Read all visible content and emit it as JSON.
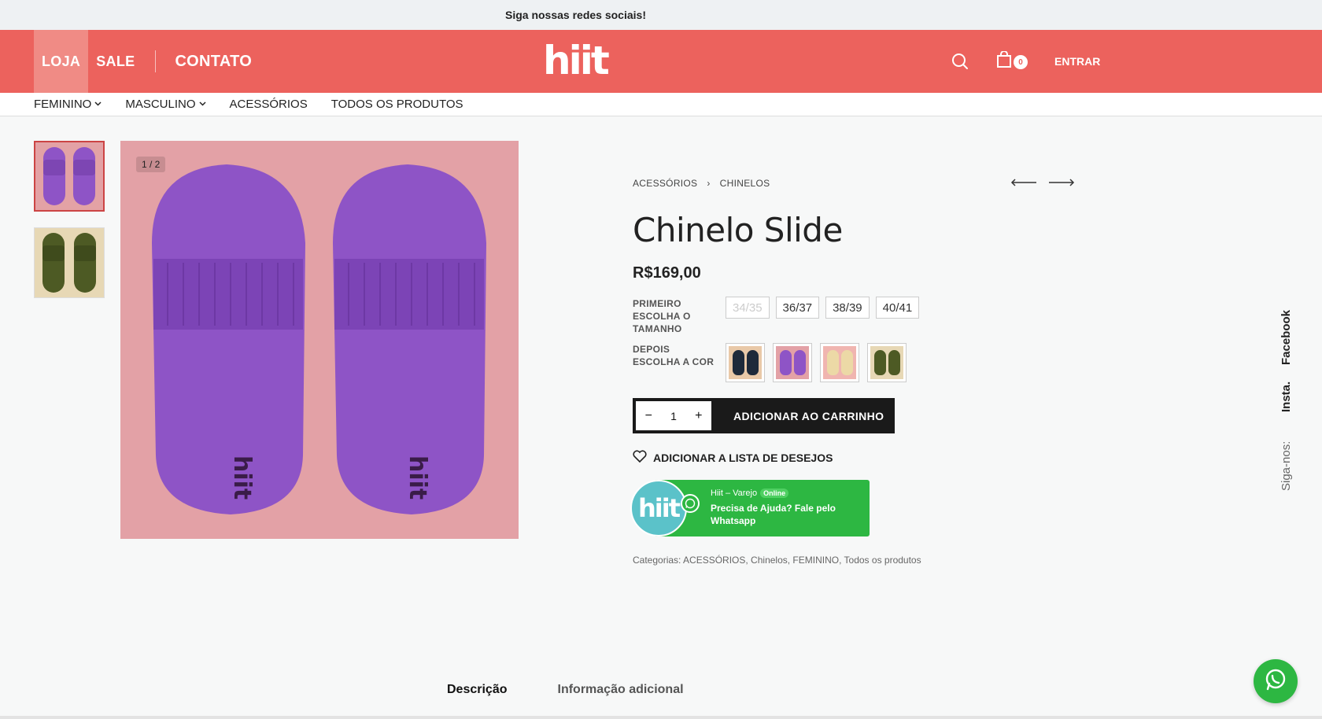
{
  "topbar": {
    "message": "Siga nossas redes sociais!"
  },
  "header": {
    "nav": {
      "loja": "LOJA",
      "sale": "SALE",
      "contato": "CONTATO"
    },
    "logo": "hiit",
    "cart_count": "0",
    "login": "ENTRAR",
    "colors": {
      "brand": "#ec625d"
    }
  },
  "catnav": {
    "items": [
      {
        "label": "FEMININO",
        "has_dropdown": true
      },
      {
        "label": "MASCULINO",
        "has_dropdown": true
      },
      {
        "label": "ACESSÓRIOS",
        "has_dropdown": false
      },
      {
        "label": "TODOS OS PRODUTOS",
        "has_dropdown": false
      }
    ]
  },
  "gallery": {
    "counter": "1 / 2",
    "thumbs": [
      "purple-slide",
      "olive-slide"
    ]
  },
  "product": {
    "breadcrumb": [
      "ACESSÓRIOS",
      "CHINELOS"
    ],
    "breadcrumb_sep": "›",
    "title": "Chinelo Slide",
    "price": "R$169,00",
    "size_label": "PRIMEIRO ESCOLHA O TAMANHO",
    "sizes": [
      {
        "label": "34/35",
        "available": false
      },
      {
        "label": "36/37",
        "available": true
      },
      {
        "label": "38/39",
        "available": true
      },
      {
        "label": "40/41",
        "available": true
      }
    ],
    "color_label": "DEPOIS ESCOLHA A COR",
    "colors": [
      {
        "name": "navy",
        "bg": "#e9c9a8",
        "slide": "#1e2a3a"
      },
      {
        "name": "purple",
        "bg": "#e3a1a6",
        "slide": "#8e54c6"
      },
      {
        "name": "cream",
        "bg": "#f0b5b0",
        "slide": "#ecd9a6"
      },
      {
        "name": "olive",
        "bg": "#e7d8b5",
        "slide": "#4d5a24"
      }
    ],
    "quantity": "1",
    "qty_minus": "−",
    "qty_plus": "+",
    "add_to_cart": "ADICIONAR AO CARRINHO",
    "wishlist": "ADICIONAR A LISTA DE DESEJOS",
    "whatsapp": {
      "name": "Hiit – Varejo",
      "status": "Online",
      "help": "Precisa de Ajuda? Fale pelo Whatsapp",
      "avatar": "hiit"
    },
    "categories": "Categorias: ACESSÓRIOS, Chinelos, FEMININO, Todos os produtos"
  },
  "tabs": [
    "Descrição",
    "Informação adicional"
  ],
  "social": {
    "facebook": "Facebook",
    "insta": "Insta.",
    "siga": "Siga-nos:"
  }
}
